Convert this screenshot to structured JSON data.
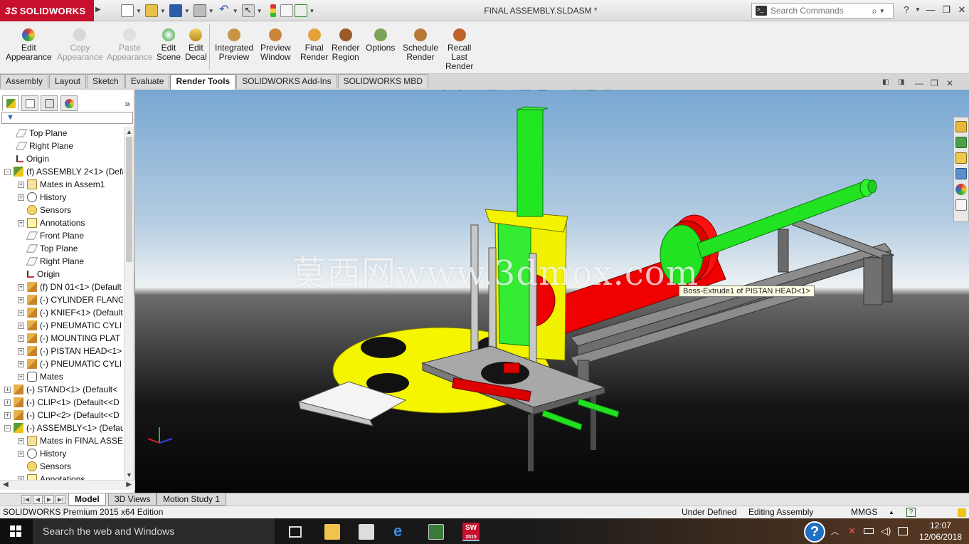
{
  "app": {
    "brand": "SOLIDWORKS",
    "brand_mark": "3S",
    "document_title": "FINAL ASSEMBLY.SLDASM *",
    "search_placeholder": "Search Commands",
    "brand_color": "#c8102e"
  },
  "ribbon": {
    "buttons": [
      {
        "label": "Edit\nAppearance",
        "icon": "appearance-icon",
        "enabled": true
      },
      {
        "label": "Copy\nAppearance",
        "icon": "copy-appearance-icon",
        "enabled": false
      },
      {
        "label": "Paste\nAppearance",
        "icon": "paste-appearance-icon",
        "enabled": false
      },
      {
        "label": "Edit\nScene",
        "icon": "scene-icon",
        "enabled": true
      },
      {
        "label": "Edit\nDecal",
        "icon": "decal-icon",
        "enabled": true
      },
      {
        "label": "Integrated\nPreview",
        "icon": "integrated-preview-icon",
        "enabled": true
      },
      {
        "label": "Preview\nWindow",
        "icon": "preview-window-icon",
        "enabled": true
      },
      {
        "label": "Final\nRender",
        "icon": "final-render-icon",
        "enabled": true
      },
      {
        "label": "Render\nRegion",
        "icon": "render-region-icon",
        "enabled": true
      },
      {
        "label": "Options",
        "icon": "options-icon",
        "enabled": true
      },
      {
        "label": "Schedule\nRender",
        "icon": "schedule-render-icon",
        "enabled": true
      },
      {
        "label": "Recall\nLast\nRender",
        "icon": "recall-render-icon",
        "enabled": true
      }
    ]
  },
  "tabs": [
    {
      "label": "Assembly",
      "active": false
    },
    {
      "label": "Layout",
      "active": false
    },
    {
      "label": "Sketch",
      "active": false
    },
    {
      "label": "Evaluate",
      "active": false
    },
    {
      "label": "Render Tools",
      "active": true
    },
    {
      "label": "SOLIDWORKS Add-Ins",
      "active": false
    },
    {
      "label": "SOLIDWORKS MBD",
      "active": false
    }
  ],
  "tree": {
    "items": [
      {
        "label": "Top Plane",
        "icon": "plane",
        "expand": "",
        "depth": 1
      },
      {
        "label": "Right Plane",
        "icon": "plane",
        "expand": "",
        "depth": 1
      },
      {
        "label": "Origin",
        "icon": "origin",
        "expand": "",
        "depth": 1
      },
      {
        "label": "(f) ASSEMBLY 2<1> (Defa",
        "icon": "assembly",
        "expand": "−",
        "depth": 0
      },
      {
        "label": "Mates in Assem1",
        "icon": "mates",
        "expand": "+",
        "depth": 2
      },
      {
        "label": "History",
        "icon": "history",
        "expand": "+",
        "depth": 2
      },
      {
        "label": "Sensors",
        "icon": "sensors",
        "expand": "",
        "depth": 2
      },
      {
        "label": "Annotations",
        "icon": "annotations",
        "expand": "+",
        "depth": 2
      },
      {
        "label": "Front Plane",
        "icon": "plane",
        "expand": "",
        "depth": 2
      },
      {
        "label": "Top Plane",
        "icon": "plane",
        "expand": "",
        "depth": 2
      },
      {
        "label": "Right Plane",
        "icon": "plane",
        "expand": "",
        "depth": 2
      },
      {
        "label": "Origin",
        "icon": "origin",
        "expand": "",
        "depth": 2
      },
      {
        "label": "(f) DN 01<1> (Default",
        "icon": "part",
        "expand": "+",
        "depth": 2
      },
      {
        "label": "(-) CYLINDER FLANGI",
        "icon": "part",
        "expand": "+",
        "depth": 2
      },
      {
        "label": "(-) KNIEF<1> (Default",
        "icon": "part",
        "expand": "+",
        "depth": 2
      },
      {
        "label": "(-) PNEUMATIC CYLI",
        "icon": "part",
        "expand": "+",
        "depth": 2
      },
      {
        "label": "(-) MOUNTING PLAT",
        "icon": "part",
        "expand": "+",
        "depth": 2
      },
      {
        "label": "(-) PISTAN HEAD<1>",
        "icon": "part",
        "expand": "+",
        "depth": 2
      },
      {
        "label": "(-) PNEUMATIC CYLI",
        "icon": "part",
        "expand": "+",
        "depth": 2
      },
      {
        "label": "Mates",
        "icon": "mates-folder",
        "expand": "+",
        "depth": 2
      },
      {
        "label": "(-) STAND<1> (Default<",
        "icon": "part",
        "expand": "+",
        "depth": 0
      },
      {
        "label": "(-) CLIP<1> (Default<<D",
        "icon": "part",
        "expand": "+",
        "depth": 0
      },
      {
        "label": "(-) CLIP<2> (Default<<D",
        "icon": "part",
        "expand": "+",
        "depth": 0
      },
      {
        "label": "(-) ASSEMBLY<1> (Defau",
        "icon": "assembly",
        "expand": "−",
        "depth": 0
      },
      {
        "label": "Mates in FINAL ASSEI",
        "icon": "mates",
        "expand": "+",
        "depth": 2
      },
      {
        "label": "History",
        "icon": "history",
        "expand": "+",
        "depth": 2
      },
      {
        "label": "Sensors",
        "icon": "sensors",
        "expand": "",
        "depth": 2
      },
      {
        "label": "Annotations",
        "icon": "annotations",
        "expand": "+",
        "depth": 2
      }
    ]
  },
  "viewport": {
    "tooltip": "Boss-Extrude1 of PISTAN HEAD<1>",
    "watermark": "莫西网www.3dmox.com"
  },
  "bottom_tabs": [
    {
      "label": "Model",
      "active": true
    },
    {
      "label": "3D Views",
      "active": false
    },
    {
      "label": "Motion Study 1",
      "active": false
    }
  ],
  "status": {
    "edition": "SOLIDWORKS Premium 2015 x64 Edition",
    "definition": "Under Defined",
    "mode": "Editing Assembly",
    "units": "MMGS",
    "units_arrow": "▲",
    "help": "?"
  },
  "taskbar": {
    "search_placeholder": "Search the web and Windows",
    "time": "12:07",
    "date": "12/06/2018",
    "help": "?",
    "sw_badge": "SW",
    "sw_year": "2015"
  }
}
